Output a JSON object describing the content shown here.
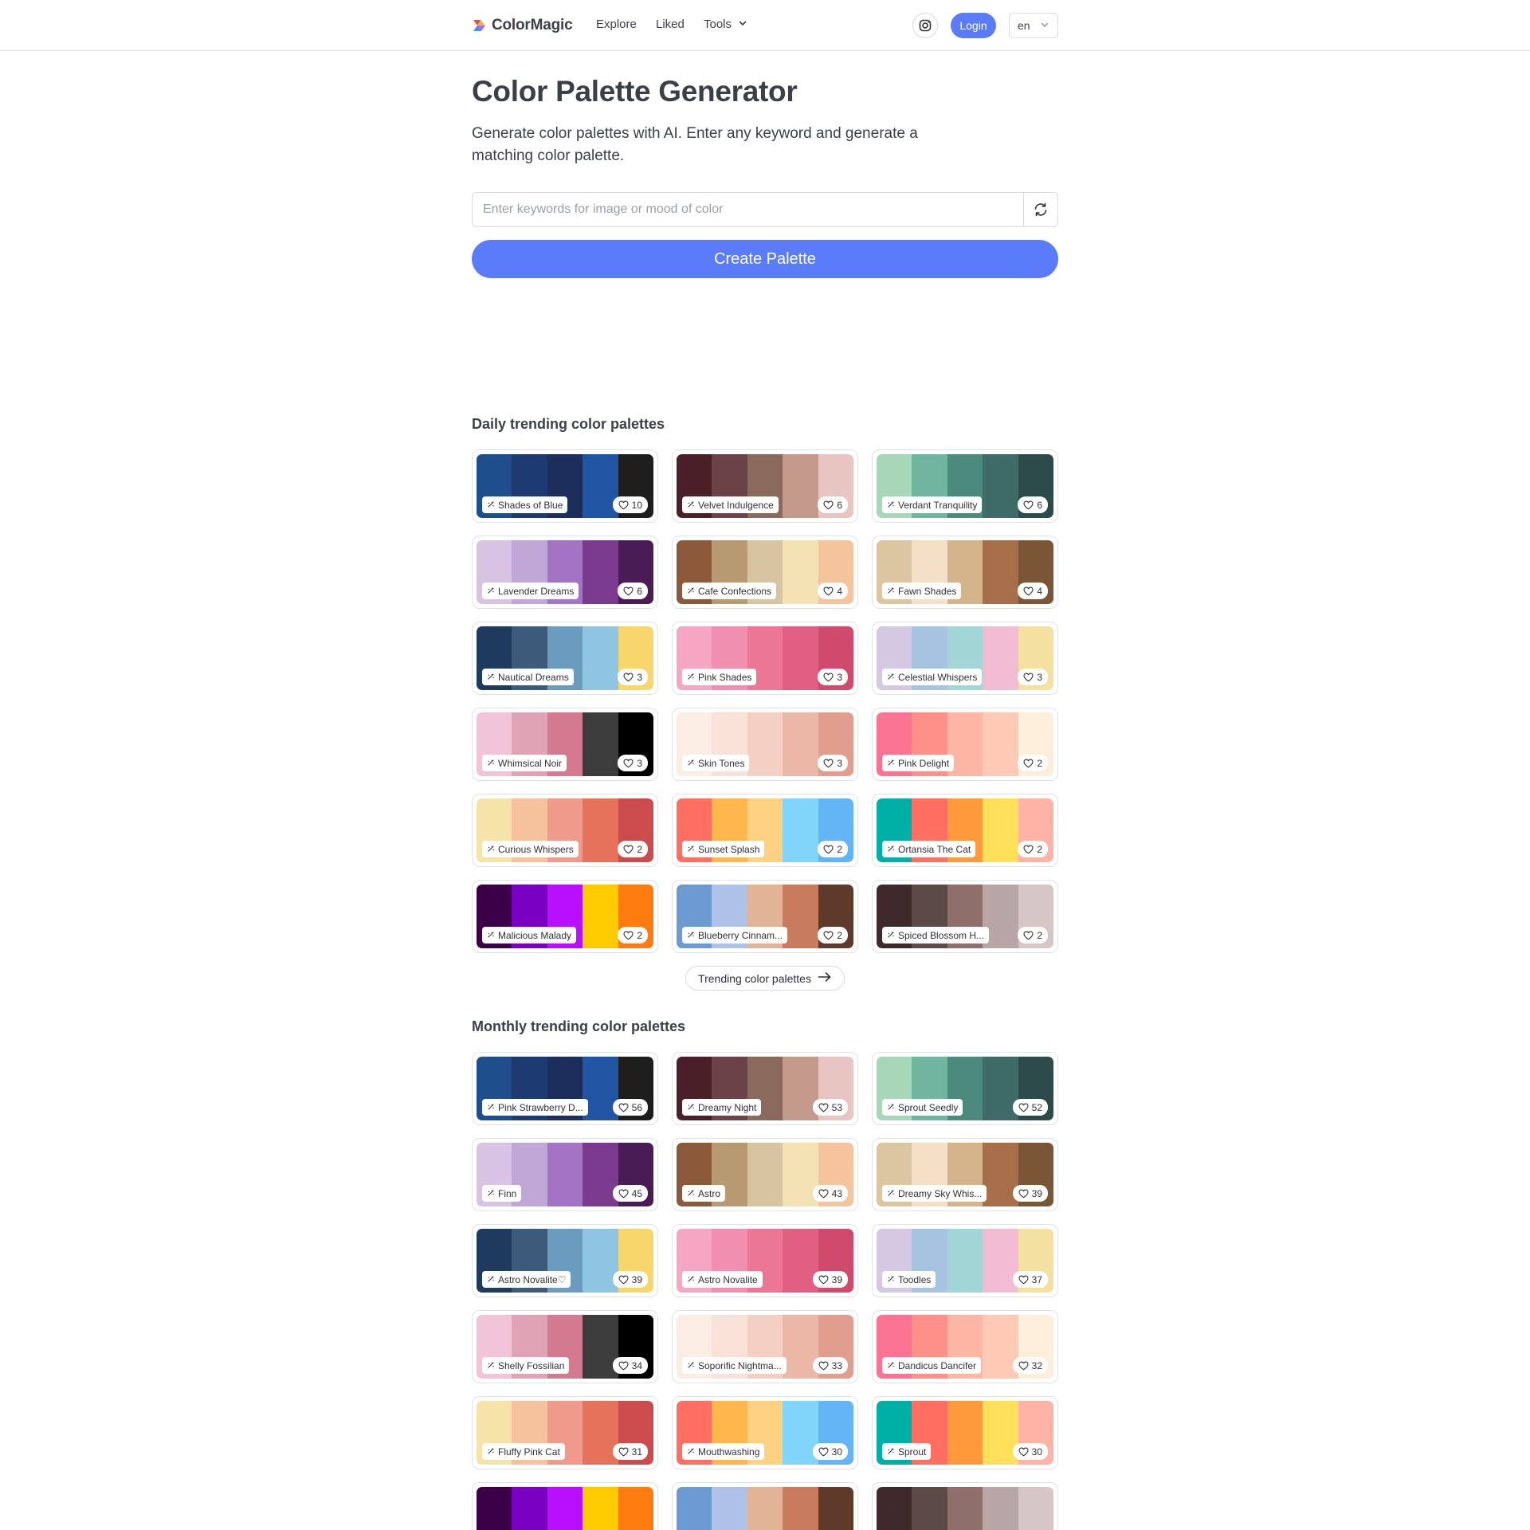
{
  "header": {
    "brand": "ColorMagic",
    "nav": {
      "explore": "Explore",
      "liked": "Liked",
      "tools": "Tools"
    },
    "login_label": "Login",
    "language": "en"
  },
  "hero": {
    "title": "Color Palette Generator",
    "subtitle": "Generate color palettes with AI. Enter any keyword and generate a matching color palette.",
    "search_placeholder": "Enter keywords for image or mood of color",
    "create_label": "Create Palette"
  },
  "daily": {
    "title": "Daily trending color palettes",
    "more_label": "Trending color palettes",
    "palettes": [
      {
        "name": "Shades of Blue",
        "likes": "10",
        "colors": [
          "#1f4e8c",
          "#1d3b71",
          "#1c2f5c",
          "#1f55a3",
          "#1e1e1e"
        ]
      },
      {
        "name": "Velvet Indulgence",
        "likes": "6",
        "colors": [
          "#4a1f28",
          "#6b4248",
          "#8b6a5e",
          "#c49a8c",
          "#e8c4c2"
        ]
      },
      {
        "name": "Verdant Tranquility",
        "likes": "6",
        "colors": [
          "#a7d7b7",
          "#6fb5a0",
          "#4b8a7d",
          "#3e6b68",
          "#2e4b4b"
        ]
      },
      {
        "name": "Lavender Dreams",
        "likes": "6",
        "colors": [
          "#d7c3e2",
          "#c0a7d8",
          "#a374c4",
          "#7a3b8e",
          "#4a1c56"
        ]
      },
      {
        "name": "Cafe Confections",
        "likes": "4",
        "colors": [
          "#8b5a3a",
          "#b89a72",
          "#d7c4a0",
          "#f4e1b4",
          "#f4c49c"
        ]
      },
      {
        "name": "Fawn Shades",
        "likes": "4",
        "colors": [
          "#dcc5a1",
          "#f3e0c6",
          "#d4b48a",
          "#a66f4a",
          "#7a5636"
        ]
      },
      {
        "name": "Nautical Dreams",
        "likes": "3",
        "colors": [
          "#1e3a5f",
          "#3c5a7a",
          "#6b9bbf",
          "#8fc5e3",
          "#f7d66c"
        ]
      },
      {
        "name": "Pink Shades",
        "likes": "3",
        "colors": [
          "#f4a6c2",
          "#f08fb0",
          "#ec7695",
          "#e05f83",
          "#d04a6e"
        ]
      },
      {
        "name": "Celestial Whispers",
        "likes": "3",
        "colors": [
          "#d5c8e3",
          "#a6c4e0",
          "#a1d5d6",
          "#f2bcd3",
          "#f4e0a1"
        ]
      },
      {
        "name": "Whimsical Noir",
        "likes": "3",
        "colors": [
          "#f2c4d7",
          "#e0a3b5",
          "#d37990",
          "#3c3c3c",
          "#000000"
        ]
      },
      {
        "name": "Skin Tones",
        "likes": "3",
        "colors": [
          "#fbece4",
          "#f8e1d6",
          "#f4d0c4",
          "#ebb7a6",
          "#e19e8f"
        ]
      },
      {
        "name": "Pink Delight",
        "likes": "2",
        "colors": [
          "#fb7393",
          "#fd918a",
          "#fdb5a4",
          "#fdcab5",
          "#fdeedb"
        ]
      },
      {
        "name": "Curious Whispers",
        "likes": "2",
        "colors": [
          "#f6e3a9",
          "#f5c29d",
          "#f09a8c",
          "#e6725b",
          "#cc4c4d"
        ]
      },
      {
        "name": "Sunset Splash",
        "likes": "2",
        "colors": [
          "#ff6f61",
          "#ffb74d",
          "#ffd180",
          "#81d4fa",
          "#64b5f6"
        ]
      },
      {
        "name": "Ortansia The Cat",
        "likes": "2",
        "colors": [
          "#00b0a6",
          "#ff6f61",
          "#ff9a3c",
          "#ffe05a",
          "#ffb3a7"
        ]
      },
      {
        "name": "Malicious Malady",
        "likes": "2",
        "colors": [
          "#3b0048",
          "#7a00c2",
          "#b80fff",
          "#ffcb00",
          "#ff7b0f"
        ]
      },
      {
        "name": "Blueberry Cinnam...",
        "likes": "2",
        "colors": [
          "#6c9bd1",
          "#aec1e6",
          "#e2b497",
          "#c97b5d",
          "#5d3a2a"
        ]
      },
      {
        "name": "Spiced Blossom H...",
        "likes": "2",
        "colors": [
          "#3e2a2b",
          "#5c4a49",
          "#8e6f6c",
          "#b7a6a5",
          "#d7c6c6"
        ]
      }
    ]
  },
  "monthly": {
    "title": "Monthly trending color palettes",
    "palettes": [
      {
        "name": "Pink Strawberry D...",
        "likes": "56",
        "colors": [
          "#1f4e8c",
          "#1d3b71",
          "#1c2f5c",
          "#1f55a3",
          "#1e1e1e"
        ]
      },
      {
        "name": "Dreamy Night",
        "likes": "53",
        "colors": [
          "#4a1f28",
          "#6b4248",
          "#8b6a5e",
          "#c49a8c",
          "#e8c4c2"
        ]
      },
      {
        "name": "Sprout Seedly",
        "likes": "52",
        "colors": [
          "#a7d7b7",
          "#6fb5a0",
          "#4b8a7d",
          "#3e6b68",
          "#2e4b4b"
        ]
      },
      {
        "name": "Finn",
        "likes": "45",
        "colors": [
          "#d7c3e2",
          "#c0a7d8",
          "#a374c4",
          "#7a3b8e",
          "#4a1c56"
        ]
      },
      {
        "name": "Astro",
        "likes": "43",
        "colors": [
          "#8b5a3a",
          "#b89a72",
          "#d7c4a0",
          "#f4e1b4",
          "#f4c49c"
        ]
      },
      {
        "name": "Dreamy Sky Whis...",
        "likes": "39",
        "colors": [
          "#dcc5a1",
          "#f3e0c6",
          "#d4b48a",
          "#a66f4a",
          "#7a5636"
        ]
      },
      {
        "name": "Astro Novalite♡",
        "likes": "39",
        "colors": [
          "#1e3a5f",
          "#3c5a7a",
          "#6b9bbf",
          "#8fc5e3",
          "#f7d66c"
        ]
      },
      {
        "name": "Astro Novalite",
        "likes": "39",
        "colors": [
          "#f4a6c2",
          "#f08fb0",
          "#ec7695",
          "#e05f83",
          "#d04a6e"
        ]
      },
      {
        "name": "Toodles",
        "likes": "37",
        "colors": [
          "#d5c8e3",
          "#a6c4e0",
          "#a1d5d6",
          "#f2bcd3",
          "#f4e0a1"
        ]
      },
      {
        "name": "Shelly Fossilian",
        "likes": "34",
        "colors": [
          "#f2c4d7",
          "#e0a3b5",
          "#d37990",
          "#3c3c3c",
          "#000000"
        ]
      },
      {
        "name": "Soporific Nightma...",
        "likes": "33",
        "colors": [
          "#fbece4",
          "#f8e1d6",
          "#f4d0c4",
          "#ebb7a6",
          "#e19e8f"
        ]
      },
      {
        "name": "Dandicus Dancifer",
        "likes": "32",
        "colors": [
          "#fb7393",
          "#fd918a",
          "#fdb5a4",
          "#fdcab5",
          "#fdeedb"
        ]
      },
      {
        "name": "Fluffy Pink Cat",
        "likes": "31",
        "colors": [
          "#f6e3a9",
          "#f5c29d",
          "#f09a8c",
          "#e6725b",
          "#cc4c4d"
        ]
      },
      {
        "name": "Mouthwashing",
        "likes": "30",
        "colors": [
          "#ff6f61",
          "#ffb74d",
          "#ffd180",
          "#81d4fa",
          "#64b5f6"
        ]
      },
      {
        "name": "Sprout",
        "likes": "30",
        "colors": [
          "#00b0a6",
          "#ff6f61",
          "#ff9a3c",
          "#ffe05a",
          "#ffb3a7"
        ]
      },
      {
        "name": "",
        "likes": "",
        "colors": [
          "#3b0048",
          "#7a00c2",
          "#b80fff",
          "#ffcb00",
          "#ff7b0f"
        ]
      },
      {
        "name": "",
        "likes": "",
        "colors": [
          "#6c9bd1",
          "#aec1e6",
          "#e2b497",
          "#c97b5d",
          "#5d3a2a"
        ]
      },
      {
        "name": "",
        "likes": "",
        "colors": [
          "#3e2a2b",
          "#5c4a49",
          "#8e6f6c",
          "#b7a6a5",
          "#d7c6c6"
        ]
      }
    ]
  },
  "colors": {
    "accent": "#5b7cfa",
    "border": "#dfe2e7",
    "text": "#3b3f47"
  }
}
